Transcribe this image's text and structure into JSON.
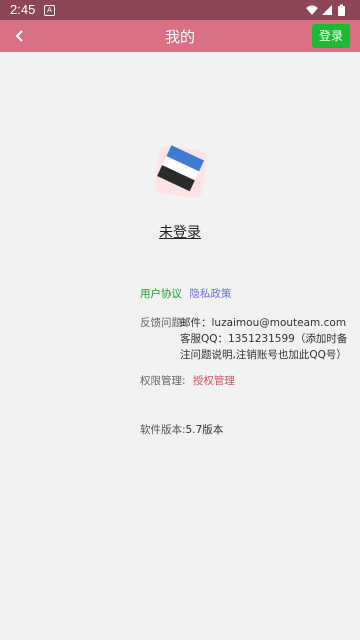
{
  "status_bar": {
    "time": "2:45",
    "notification_glyph": "A"
  },
  "app_bar": {
    "title": "我的",
    "login_label": "登录"
  },
  "profile": {
    "user_status": "未登录"
  },
  "links": {
    "user_agreement": "用户协议",
    "privacy_policy": "隐私政策"
  },
  "feedback": {
    "label": "反馈问题:",
    "email_line": "邮件：luzaimou@mouteam.com",
    "qq_line": "客服QQ：1351231599（添加时备注问题说明,注销账号也加此QQ号）"
  },
  "permission": {
    "label": "权限管理:",
    "link": "授权管理"
  },
  "version": {
    "label": "软件版本:",
    "value": "5.7版本"
  },
  "colors": {
    "status_bar": "#8e4556",
    "app_bar": "#d96f82",
    "login_button": "#1bb934",
    "link_green": "#1aa02d",
    "link_blue": "#6b72e6",
    "link_pink": "#d3566b"
  }
}
